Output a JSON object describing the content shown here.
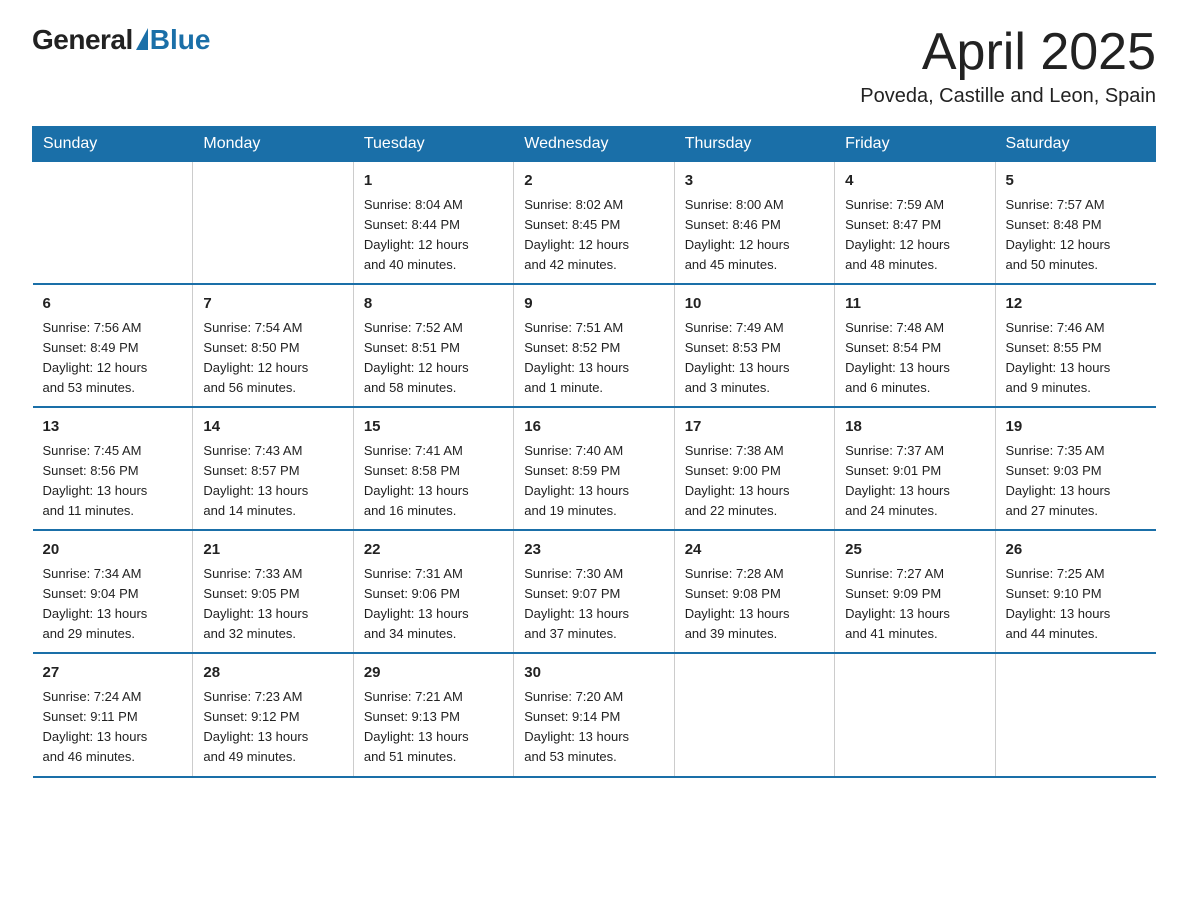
{
  "logo": {
    "general": "General",
    "blue": "Blue"
  },
  "header": {
    "month": "April 2025",
    "location": "Poveda, Castille and Leon, Spain"
  },
  "weekdays": [
    "Sunday",
    "Monday",
    "Tuesday",
    "Wednesday",
    "Thursday",
    "Friday",
    "Saturday"
  ],
  "weeks": [
    [
      {
        "day": "",
        "info": ""
      },
      {
        "day": "",
        "info": ""
      },
      {
        "day": "1",
        "info": "Sunrise: 8:04 AM\nSunset: 8:44 PM\nDaylight: 12 hours\nand 40 minutes."
      },
      {
        "day": "2",
        "info": "Sunrise: 8:02 AM\nSunset: 8:45 PM\nDaylight: 12 hours\nand 42 minutes."
      },
      {
        "day": "3",
        "info": "Sunrise: 8:00 AM\nSunset: 8:46 PM\nDaylight: 12 hours\nand 45 minutes."
      },
      {
        "day": "4",
        "info": "Sunrise: 7:59 AM\nSunset: 8:47 PM\nDaylight: 12 hours\nand 48 minutes."
      },
      {
        "day": "5",
        "info": "Sunrise: 7:57 AM\nSunset: 8:48 PM\nDaylight: 12 hours\nand 50 minutes."
      }
    ],
    [
      {
        "day": "6",
        "info": "Sunrise: 7:56 AM\nSunset: 8:49 PM\nDaylight: 12 hours\nand 53 minutes."
      },
      {
        "day": "7",
        "info": "Sunrise: 7:54 AM\nSunset: 8:50 PM\nDaylight: 12 hours\nand 56 minutes."
      },
      {
        "day": "8",
        "info": "Sunrise: 7:52 AM\nSunset: 8:51 PM\nDaylight: 12 hours\nand 58 minutes."
      },
      {
        "day": "9",
        "info": "Sunrise: 7:51 AM\nSunset: 8:52 PM\nDaylight: 13 hours\nand 1 minute."
      },
      {
        "day": "10",
        "info": "Sunrise: 7:49 AM\nSunset: 8:53 PM\nDaylight: 13 hours\nand 3 minutes."
      },
      {
        "day": "11",
        "info": "Sunrise: 7:48 AM\nSunset: 8:54 PM\nDaylight: 13 hours\nand 6 minutes."
      },
      {
        "day": "12",
        "info": "Sunrise: 7:46 AM\nSunset: 8:55 PM\nDaylight: 13 hours\nand 9 minutes."
      }
    ],
    [
      {
        "day": "13",
        "info": "Sunrise: 7:45 AM\nSunset: 8:56 PM\nDaylight: 13 hours\nand 11 minutes."
      },
      {
        "day": "14",
        "info": "Sunrise: 7:43 AM\nSunset: 8:57 PM\nDaylight: 13 hours\nand 14 minutes."
      },
      {
        "day": "15",
        "info": "Sunrise: 7:41 AM\nSunset: 8:58 PM\nDaylight: 13 hours\nand 16 minutes."
      },
      {
        "day": "16",
        "info": "Sunrise: 7:40 AM\nSunset: 8:59 PM\nDaylight: 13 hours\nand 19 minutes."
      },
      {
        "day": "17",
        "info": "Sunrise: 7:38 AM\nSunset: 9:00 PM\nDaylight: 13 hours\nand 22 minutes."
      },
      {
        "day": "18",
        "info": "Sunrise: 7:37 AM\nSunset: 9:01 PM\nDaylight: 13 hours\nand 24 minutes."
      },
      {
        "day": "19",
        "info": "Sunrise: 7:35 AM\nSunset: 9:03 PM\nDaylight: 13 hours\nand 27 minutes."
      }
    ],
    [
      {
        "day": "20",
        "info": "Sunrise: 7:34 AM\nSunset: 9:04 PM\nDaylight: 13 hours\nand 29 minutes."
      },
      {
        "day": "21",
        "info": "Sunrise: 7:33 AM\nSunset: 9:05 PM\nDaylight: 13 hours\nand 32 minutes."
      },
      {
        "day": "22",
        "info": "Sunrise: 7:31 AM\nSunset: 9:06 PM\nDaylight: 13 hours\nand 34 minutes."
      },
      {
        "day": "23",
        "info": "Sunrise: 7:30 AM\nSunset: 9:07 PM\nDaylight: 13 hours\nand 37 minutes."
      },
      {
        "day": "24",
        "info": "Sunrise: 7:28 AM\nSunset: 9:08 PM\nDaylight: 13 hours\nand 39 minutes."
      },
      {
        "day": "25",
        "info": "Sunrise: 7:27 AM\nSunset: 9:09 PM\nDaylight: 13 hours\nand 41 minutes."
      },
      {
        "day": "26",
        "info": "Sunrise: 7:25 AM\nSunset: 9:10 PM\nDaylight: 13 hours\nand 44 minutes."
      }
    ],
    [
      {
        "day": "27",
        "info": "Sunrise: 7:24 AM\nSunset: 9:11 PM\nDaylight: 13 hours\nand 46 minutes."
      },
      {
        "day": "28",
        "info": "Sunrise: 7:23 AM\nSunset: 9:12 PM\nDaylight: 13 hours\nand 49 minutes."
      },
      {
        "day": "29",
        "info": "Sunrise: 7:21 AM\nSunset: 9:13 PM\nDaylight: 13 hours\nand 51 minutes."
      },
      {
        "day": "30",
        "info": "Sunrise: 7:20 AM\nSunset: 9:14 PM\nDaylight: 13 hours\nand 53 minutes."
      },
      {
        "day": "",
        "info": ""
      },
      {
        "day": "",
        "info": ""
      },
      {
        "day": "",
        "info": ""
      }
    ]
  ]
}
